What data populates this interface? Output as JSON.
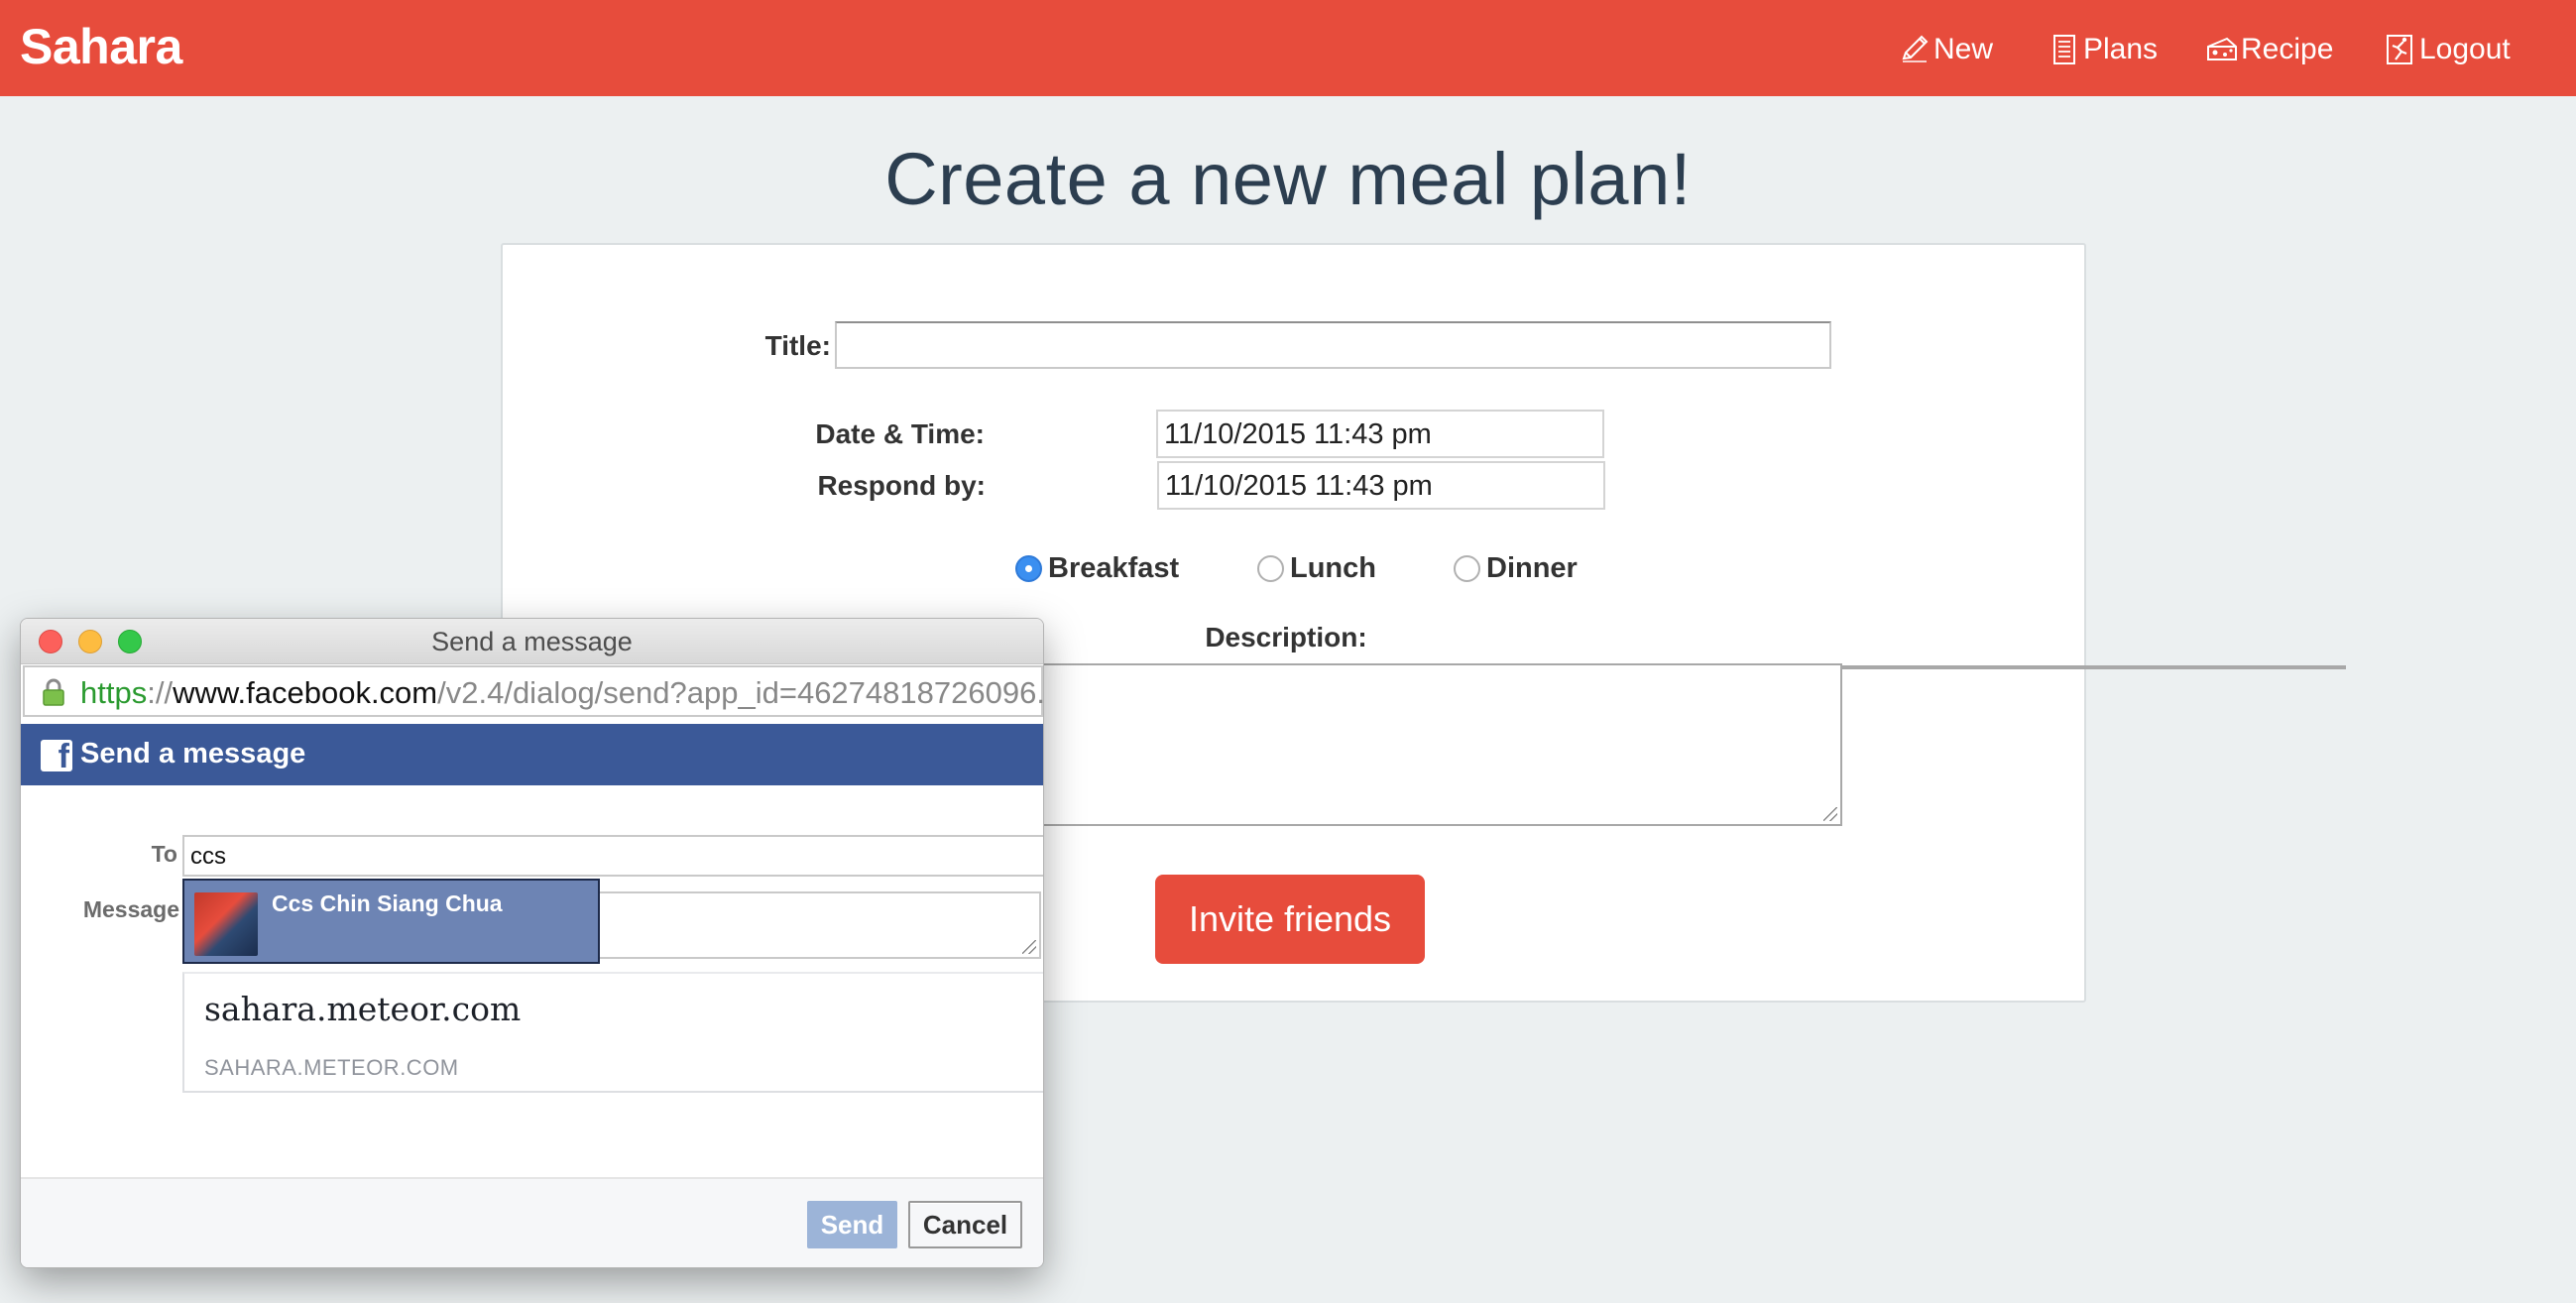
{
  "navbar": {
    "brand": "Sahara",
    "items": [
      {
        "label": "New",
        "icon": "pencil-icon"
      },
      {
        "label": "Plans",
        "icon": "list-document-icon"
      },
      {
        "label": "Recipe",
        "icon": "cheese-icon"
      },
      {
        "label": "Logout",
        "icon": "exit-icon"
      }
    ],
    "bg_color": "#e74c3c"
  },
  "page": {
    "title": "Create a new meal plan!"
  },
  "form": {
    "title_label": "Title:",
    "title_value": "",
    "date_label": "Date & Time:",
    "date_value": "11/10/2015 11:43 pm",
    "respond_label": "Respond by:",
    "respond_value": "11/10/2015 11:43 pm",
    "meals": [
      {
        "label": "Breakfast",
        "checked": true
      },
      {
        "label": "Lunch",
        "checked": false
      },
      {
        "label": "Dinner",
        "checked": false
      }
    ],
    "description_label": "Description:",
    "invite_button": "Invite friends"
  },
  "popup": {
    "window_title": "Send a message",
    "url": {
      "scheme": "https",
      "sep": "://",
      "domain": "www.facebook.com",
      "path": "/v2.4/dialog/send?app_id=46274818726096..."
    },
    "header_title": "Send a message",
    "to_label": "To",
    "to_value": "ccs",
    "message_label": "Message",
    "suggestion_name": "Ccs Chin Siang Chua",
    "link_title": "sahara.meteor.com",
    "link_domain": "SAHARA.METEOR.COM",
    "send_button": "Send",
    "cancel_button": "Cancel",
    "fb_color": "#3b5998"
  }
}
